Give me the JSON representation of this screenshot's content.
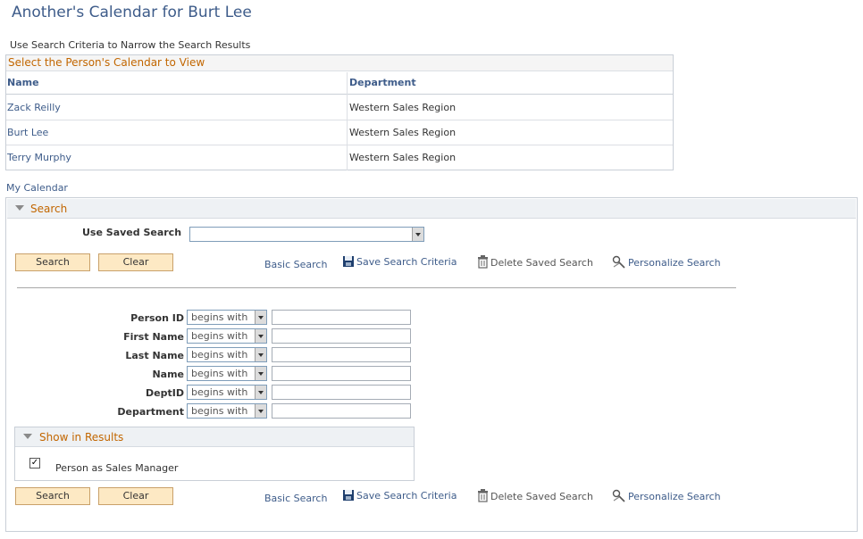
{
  "page": {
    "title": "Another's Calendar for Burt Lee",
    "instructions": "Use Search Criteria to Narrow the Search Results"
  },
  "grid": {
    "caption": "Select the Person's Calendar to View",
    "columns": [
      "Name",
      "Department"
    ],
    "rows": [
      {
        "name": "Zack Reilly",
        "department": "Western Sales Region"
      },
      {
        "name": "Burt Lee",
        "department": "Western Sales Region"
      },
      {
        "name": "Terry Murphy",
        "department": "Western Sales Region"
      }
    ]
  },
  "my_calendar_link": "My Calendar",
  "search": {
    "section_title": "Search",
    "saved_search_label": "Use Saved Search",
    "saved_search_value": "",
    "search_button": "Search",
    "clear_button": "Clear",
    "basic_search": "Basic Search",
    "save_criteria": "Save Search Criteria",
    "delete_saved": "Delete Saved Search",
    "personalize": "Personalize Search",
    "criteria": [
      {
        "label": "Person ID",
        "operator": "begins with",
        "value": ""
      },
      {
        "label": "First Name",
        "operator": "begins with",
        "value": ""
      },
      {
        "label": "Last Name",
        "operator": "begins with",
        "value": ""
      },
      {
        "label": "Name",
        "operator": "begins with",
        "value": ""
      },
      {
        "label": "DeptID",
        "operator": "begins with",
        "value": ""
      },
      {
        "label": "Department",
        "operator": "begins with",
        "value": ""
      }
    ],
    "show_in_results": {
      "title": "Show in Results",
      "option_label": "Person as Sales Manager",
      "option_checked": true,
      "check_mark": "✓"
    }
  },
  "colors": {
    "link": "#3e5c8a",
    "section_title": "#c26600",
    "button_bg": "#fde9c4"
  }
}
